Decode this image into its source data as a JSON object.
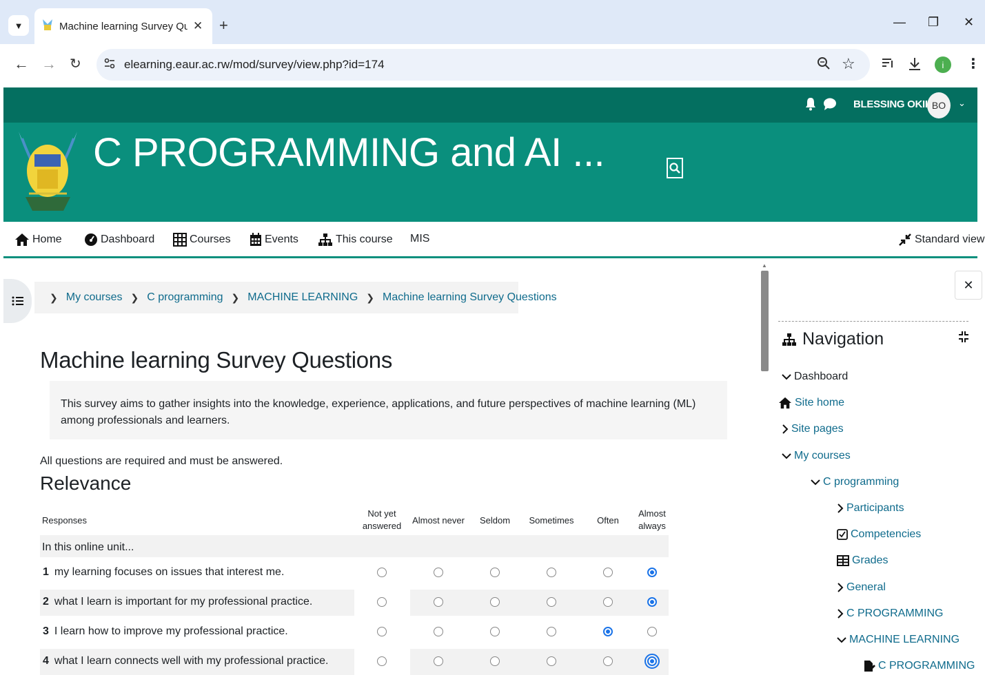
{
  "browser": {
    "tab_title": "Machine learning Survey Questi",
    "url": "elearning.eaur.ac.rw/mod/survey/view.php?id=174",
    "profile_initial": "i"
  },
  "header": {
    "user_name": "BLESSING OKIKI",
    "avatar_initials": "BO",
    "course_title": "C PROGRAMMING and AI ..."
  },
  "nav": {
    "items": [
      {
        "label": "Home",
        "icon": "home-icon"
      },
      {
        "label": "Dashboard",
        "icon": "dashboard-icon"
      },
      {
        "label": "Courses",
        "icon": "grid-icon"
      },
      {
        "label": "Events",
        "icon": "calendar-icon"
      },
      {
        "label": "This course",
        "icon": "sitemap-icon"
      },
      {
        "label": "MIS",
        "icon": ""
      }
    ],
    "standard_view": "Standard view"
  },
  "breadcrumb": [
    "My courses",
    "C programming",
    "MACHINE LEARNING",
    "Machine learning Survey Questions"
  ],
  "page": {
    "title": "Machine learning Survey Questions",
    "intro": "This survey aims to gather insights into the knowledge, experience, applications, and future perspectives of machine learning (ML) among professionals and learners.",
    "required_note": "All questions are required and must be answered.",
    "section": "Relevance"
  },
  "survey": {
    "responses_label": "Responses",
    "columns": [
      "Not yet answered",
      "Almost never",
      "Seldom",
      "Sometimes",
      "Often",
      "Almost always"
    ],
    "group_label": "In this online unit...",
    "questions": [
      {
        "num": "1",
        "text": "my learning focuses on issues that interest me.",
        "selected": 5
      },
      {
        "num": "2",
        "text": "what I learn is important for my professional practice.",
        "selected": 5
      },
      {
        "num": "3",
        "text": "I learn how to improve my professional practice.",
        "selected": 4
      },
      {
        "num": "4",
        "text": "what I learn connects well with my professional practice.",
        "selected": 5
      }
    ]
  },
  "drawer": {
    "heading": "Navigation",
    "items": [
      {
        "label": "Dashboard",
        "icon": "chevron-down-icon",
        "level": 0,
        "dark": true
      },
      {
        "label": "Site home",
        "icon": "home-icon",
        "level": 0,
        "dark": false
      },
      {
        "label": "Site pages",
        "icon": "chevron-right-icon",
        "level": 0,
        "dark": false
      },
      {
        "label": "My courses",
        "icon": "chevron-down-icon",
        "level": 0,
        "dark": false
      },
      {
        "label": "C programming",
        "icon": "chevron-down-icon",
        "level": 1,
        "dark": false
      },
      {
        "label": "Participants",
        "icon": "chevron-right-icon",
        "level": 2,
        "dark": false
      },
      {
        "label": "Competencies",
        "icon": "check-square-icon",
        "level": 2,
        "dark": false
      },
      {
        "label": "Grades",
        "icon": "table-icon",
        "level": 2,
        "dark": false
      },
      {
        "label": "General",
        "icon": "chevron-right-icon",
        "level": 2,
        "dark": false
      },
      {
        "label": "C PROGRAMMING",
        "icon": "chevron-right-icon",
        "level": 2,
        "dark": false
      },
      {
        "label": "MACHINE LEARNING",
        "icon": "chevron-down-icon",
        "level": 2,
        "dark": false
      },
      {
        "label": "C PROGRAMMING",
        "icon": "page-edit-icon",
        "level": 3,
        "dark": false
      }
    ]
  }
}
